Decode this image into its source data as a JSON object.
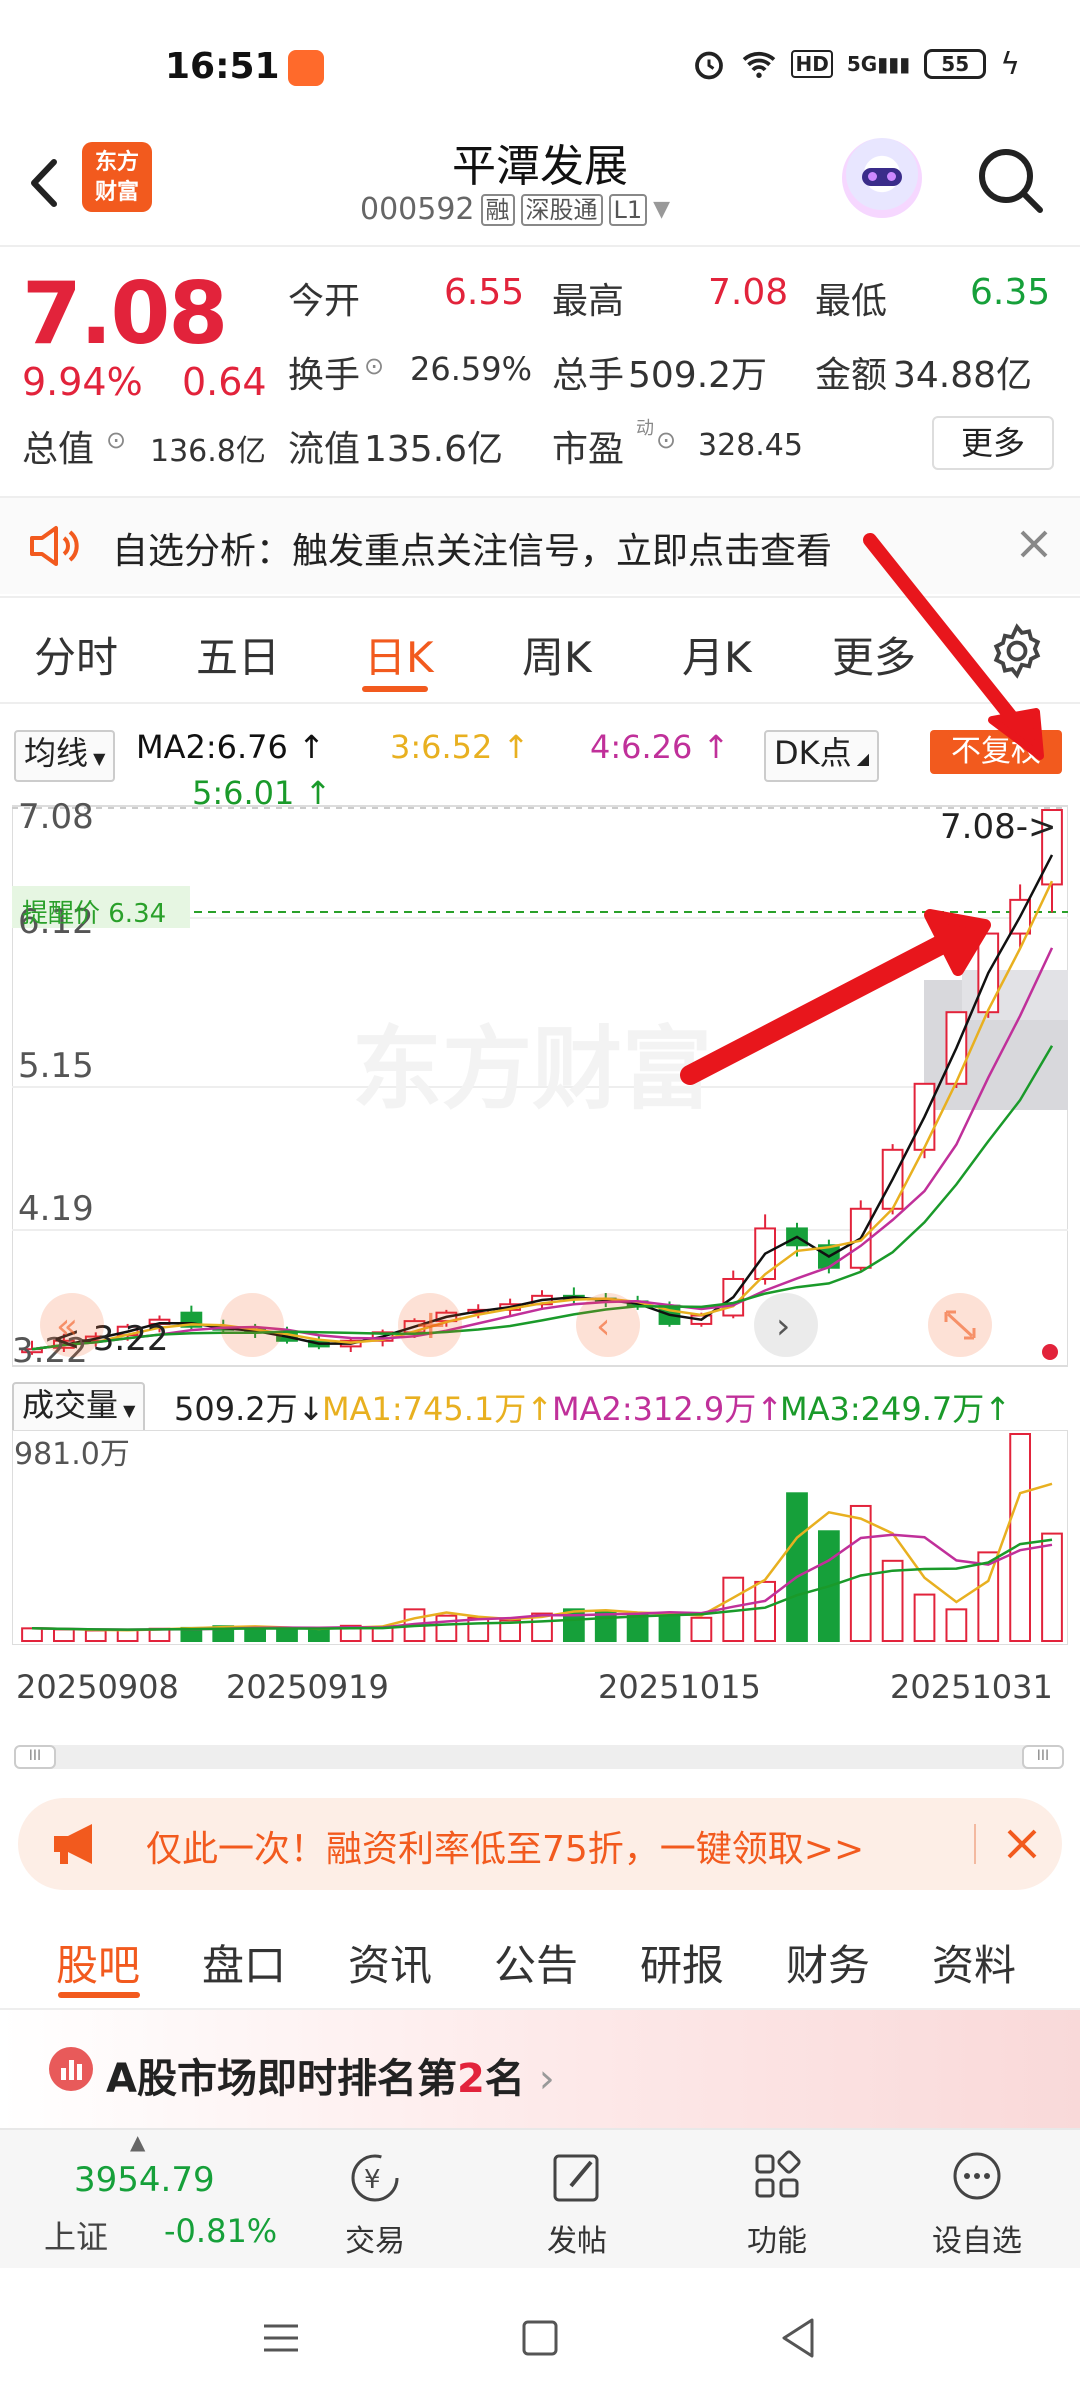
{
  "status": {
    "time": "16:51",
    "battery": "55",
    "network": "5G",
    "hd": "HD"
  },
  "header": {
    "app_logo": "东方\n财富",
    "stock_name": "平潭发展",
    "stock_code": "000592",
    "tags": [
      "融",
      "深股通",
      "L1"
    ]
  },
  "quote": {
    "price": "7.08",
    "change_pct": "9.94%",
    "change_amt": "0.64",
    "open_label": "今开",
    "open": "6.55",
    "high_label": "最高",
    "high": "7.08",
    "low_label": "最低",
    "low": "6.35",
    "turnover_label": "换手",
    "turnover": "26.59%",
    "volume_label": "总手",
    "volume": "509.2万",
    "amount_label": "金额",
    "amount": "34.88亿",
    "mktcap_label": "总值",
    "mktcap": "136.8亿",
    "float_label": "流值",
    "float": "135.6亿",
    "pe_label": "市盈",
    "pe_sup": "动",
    "pe": "328.45",
    "more_label": "更多"
  },
  "notice": {
    "text": "自选分析：触发重点关注信号，立即点击查看"
  },
  "tabs": [
    "分时",
    "五日",
    "日K",
    "周K",
    "月K",
    "更多"
  ],
  "active_tab": "日K",
  "ma_legend": {
    "selector": "均线",
    "ma2": "MA2:6.76",
    "ma3": "3:6.52",
    "ma4": "4:6.26",
    "ma5": "5:6.01",
    "dk": "DK点",
    "badge": "不复权"
  },
  "chart_labels": {
    "y_top": "7.08",
    "y1": "6.12",
    "y2": "5.15",
    "y3": "4.19",
    "y_bottom": "3.22",
    "last_price": "7.08->",
    "low_marker": "<-3.22",
    "alert": "提醒价 6.34",
    "watermark": "东方财富"
  },
  "colors": {
    "up": "#e2233b",
    "down": "#16a03a",
    "accent": "#f25a1e",
    "ma2": "#111111",
    "ma3": "#e8b020",
    "ma4": "#c0309a",
    "ma5": "#1a9a2a"
  },
  "volume": {
    "selector": "成交量",
    "value": "509.2万",
    "ma1": "MA1:745.1万",
    "ma2": "MA2:312.9万",
    "ma3": "MA3:249.7万",
    "max": "981.0万"
  },
  "dates": [
    "20250908",
    "20250919",
    "20251015",
    "20251031"
  ],
  "promo": {
    "text": "仅此一次！融资利率低至75折，一键领取>>"
  },
  "subtabs": [
    "股吧",
    "盘口",
    "资讯",
    "公告",
    "研报",
    "财务",
    "资料"
  ],
  "active_subtab": "股吧",
  "rank": {
    "text_a": "A股市场即时排名第",
    "rank_num": "2",
    "text_b": "名"
  },
  "bottom": {
    "index_value": "3954.79",
    "index_name": "上证",
    "index_change": "-0.81%",
    "trade": "交易",
    "post": "发帖",
    "function": "功能",
    "add_watch": "设自选"
  },
  "chart_data": {
    "type": "candlestick",
    "ylim": [
      3.22,
      7.08
    ],
    "candles": [
      {
        "o": 3.22,
        "h": 3.3,
        "l": 3.2,
        "c": 3.24
      },
      {
        "o": 3.25,
        "h": 3.35,
        "l": 3.22,
        "c": 3.3
      },
      {
        "o": 3.3,
        "h": 3.36,
        "l": 3.26,
        "c": 3.33
      },
      {
        "o": 3.34,
        "h": 3.42,
        "l": 3.3,
        "c": 3.4
      },
      {
        "o": 3.42,
        "h": 3.48,
        "l": 3.36,
        "c": 3.45
      },
      {
        "o": 3.5,
        "h": 3.55,
        "l": 3.38,
        "c": 3.4
      },
      {
        "o": 3.4,
        "h": 3.45,
        "l": 3.35,
        "c": 3.38
      },
      {
        "o": 3.38,
        "h": 3.42,
        "l": 3.32,
        "c": 3.36
      },
      {
        "o": 3.36,
        "h": 3.4,
        "l": 3.28,
        "c": 3.3
      },
      {
        "o": 3.3,
        "h": 3.34,
        "l": 3.24,
        "c": 3.26
      },
      {
        "o": 3.26,
        "h": 3.32,
        "l": 3.22,
        "c": 3.3
      },
      {
        "o": 3.3,
        "h": 3.38,
        "l": 3.26,
        "c": 3.36
      },
      {
        "o": 3.36,
        "h": 3.46,
        "l": 3.32,
        "c": 3.44
      },
      {
        "o": 3.44,
        "h": 3.52,
        "l": 3.4,
        "c": 3.5
      },
      {
        "o": 3.5,
        "h": 3.56,
        "l": 3.46,
        "c": 3.52
      },
      {
        "o": 3.52,
        "h": 3.6,
        "l": 3.48,
        "c": 3.56
      },
      {
        "o": 3.56,
        "h": 3.66,
        "l": 3.52,
        "c": 3.62
      },
      {
        "o": 3.62,
        "h": 3.68,
        "l": 3.56,
        "c": 3.6
      },
      {
        "o": 3.6,
        "h": 3.64,
        "l": 3.54,
        "c": 3.58
      },
      {
        "o": 3.58,
        "h": 3.62,
        "l": 3.52,
        "c": 3.55
      },
      {
        "o": 3.55,
        "h": 3.58,
        "l": 3.4,
        "c": 3.42
      },
      {
        "o": 3.42,
        "h": 3.5,
        "l": 3.4,
        "c": 3.48
      },
      {
        "o": 3.48,
        "h": 3.8,
        "l": 3.46,
        "c": 3.74
      },
      {
        "o": 3.74,
        "h": 4.2,
        "l": 3.7,
        "c": 4.1
      },
      {
        "o": 4.1,
        "h": 4.14,
        "l": 3.9,
        "c": 3.98
      },
      {
        "o": 3.98,
        "h": 4.02,
        "l": 3.78,
        "c": 3.82
      },
      {
        "o": 3.82,
        "h": 4.3,
        "l": 3.8,
        "c": 4.24
      },
      {
        "o": 4.24,
        "h": 4.7,
        "l": 4.2,
        "c": 4.66
      },
      {
        "o": 4.66,
        "h": 5.13,
        "l": 4.6,
        "c": 5.13
      },
      {
        "o": 5.13,
        "h": 5.64,
        "l": 5.1,
        "c": 5.64
      },
      {
        "o": 5.64,
        "h": 6.2,
        "l": 5.6,
        "c": 6.2
      },
      {
        "o": 6.2,
        "h": 6.55,
        "l": 6.1,
        "c": 6.44
      },
      {
        "o": 6.55,
        "h": 7.08,
        "l": 6.35,
        "c": 7.08
      }
    ],
    "volumes": [
      60,
      55,
      50,
      52,
      58,
      62,
      70,
      68,
      60,
      55,
      72,
      65,
      150,
      120,
      110,
      98,
      130,
      150,
      142,
      128,
      132,
      110,
      300,
      280,
      700,
      520,
      640,
      380,
      220,
      150,
      420,
      981,
      509
    ]
  }
}
